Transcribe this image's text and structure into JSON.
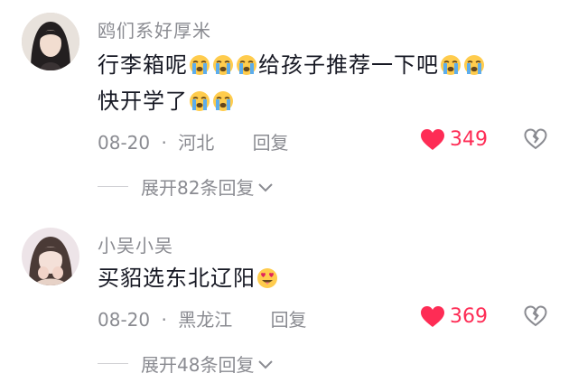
{
  "comments": [
    {
      "username": "鸥们系好厚米",
      "line1_a": "行李箱呢",
      "line1_b": "给孩子推荐一下吧",
      "line2": "快开学了",
      "date": "08-20",
      "location": "河北",
      "reply_label": "回复",
      "likes": "349",
      "expand_label": "展开82条回复"
    },
    {
      "username": "小吴小吴",
      "text": "买貂选东北辽阳",
      "date": "08-20",
      "location": "黑龙江",
      "reply_label": "回复",
      "likes": "369",
      "expand_label": "展开48条回复"
    }
  ],
  "separator": "·",
  "colors": {
    "like": "#fe2c55",
    "meta": "#8a8b91",
    "text": "#161823"
  },
  "icons": {
    "cry": "crying-emoji-icon",
    "heart_eyes": "heart-eyes-emoji-icon",
    "like": "heart-icon",
    "dislike": "broken-heart-icon",
    "chevron": "chevron-down-icon"
  }
}
